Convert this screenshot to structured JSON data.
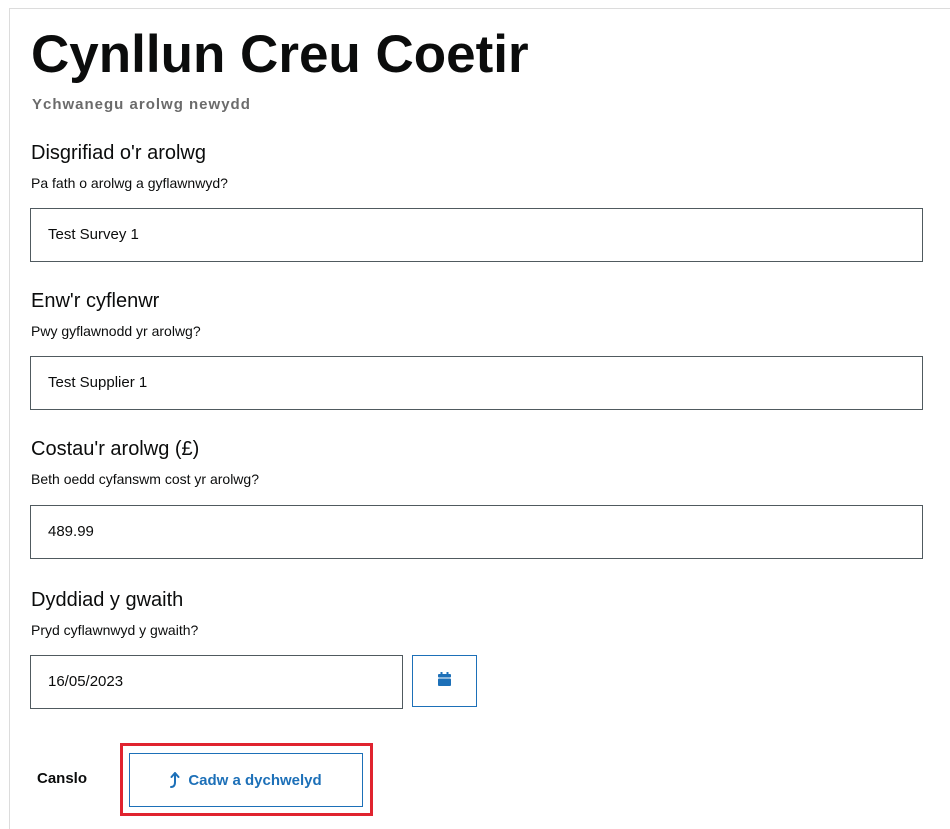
{
  "header": {
    "title": "Cynllun Creu Coetir",
    "subtitle": "Ychwanegu arolwg newydd"
  },
  "form": {
    "description": {
      "label": "Disgrifiad o'r arolwg",
      "hint": "Pa fath o arolwg a gyflawnwyd?",
      "value": "Test Survey 1"
    },
    "supplier": {
      "label": "Enw'r cyflenwr",
      "hint": "Pwy gyflawnodd yr arolwg?",
      "value": "Test Supplier 1"
    },
    "cost": {
      "label": "Costau'r arolwg (£)",
      "hint": "Beth oedd cyfanswm cost yr arolwg?",
      "value": "489.99"
    },
    "date": {
      "label": "Dyddiad y gwaith",
      "hint": "Pryd cyflawnwyd y gwaith?",
      "value": "16/05/2023",
      "calendar_icon": "calendar-icon"
    }
  },
  "actions": {
    "cancel_label": "Canslo",
    "save_label": "Cadw a dychwelyd",
    "save_icon": "return-arrow-icon"
  },
  "colors": {
    "accent": "#1d70b8",
    "highlight": "#e0232f",
    "subtitle": "#6b6b6b"
  }
}
